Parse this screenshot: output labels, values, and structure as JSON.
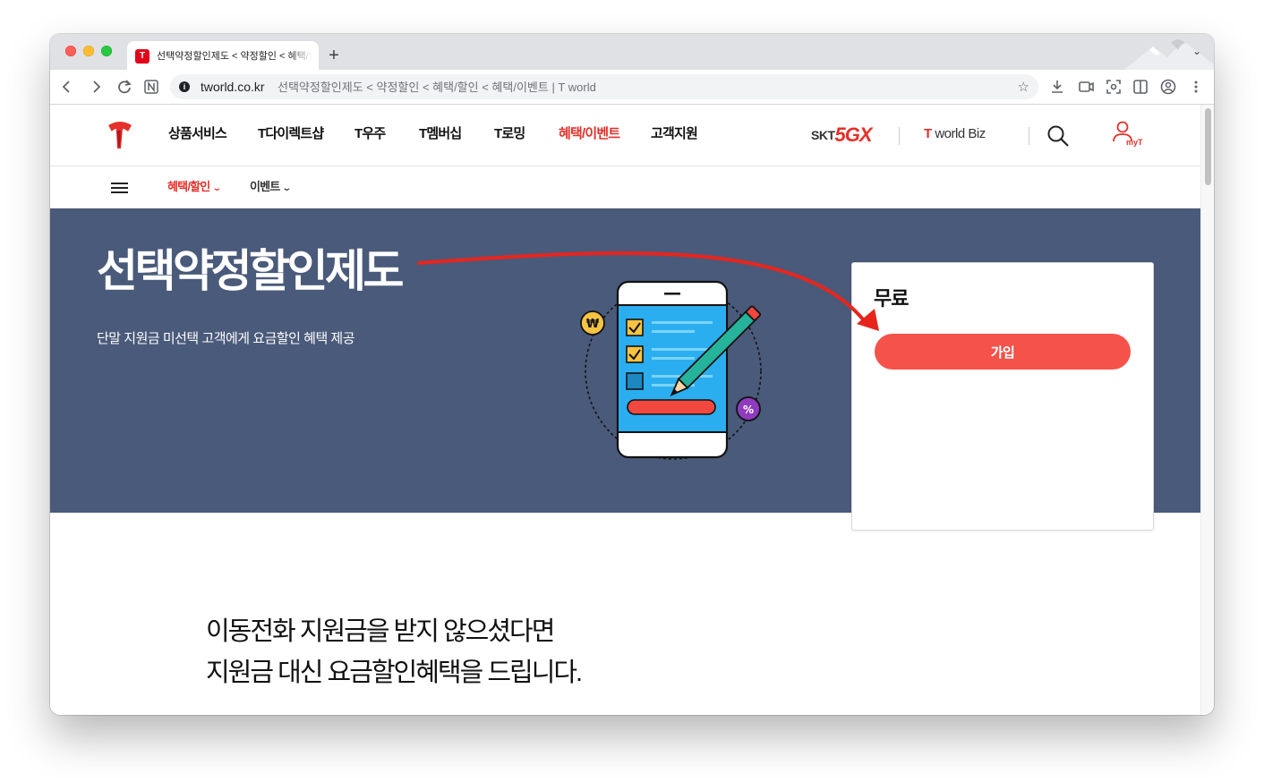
{
  "browser": {
    "tab_title": "선택약정할인제도 < 약정할인 < 혜택/할인 < 혜택/이벤트 | T world",
    "new_tab_label": "+",
    "tab_favicon_label": "T",
    "address": {
      "host": "tworld.co.kr",
      "title": "선택약정할인제도 < 약정할인 < 혜택/할인 < 혜택/이벤트 | T world"
    },
    "nav_icons": [
      "back-icon",
      "forward-icon",
      "reload-icon",
      "n-extension-icon"
    ],
    "toolbar_icons": [
      "bookmark-star-icon",
      "download-icon",
      "cast-icon",
      "screenshot-icon",
      "sidebar-icon",
      "profile-icon",
      "more-menu-icon"
    ]
  },
  "gnb": {
    "menu": [
      "상품서비스",
      "T다이렉트샵",
      "T우주",
      "T멤버십",
      "T로밍",
      "혜택/이벤트",
      "고객지원"
    ],
    "active_index": 5,
    "skt_label": "SKT",
    "fiveg_label": "5GX",
    "worldbiz_label": "world Biz",
    "myt_label": "myT"
  },
  "lnb": {
    "items": [
      "혜택/할인",
      "이벤트"
    ],
    "active_index": 0
  },
  "hero": {
    "title": "선택약정할인제도",
    "description": "단말 지원금 미선택 고객에게 요금할인 혜택 제공",
    "coin_symbol": "₩",
    "percent_symbol": "%"
  },
  "card": {
    "price": "무료",
    "join_label": "가입"
  },
  "content": {
    "headline_line1": "이동전화 지원금을 받지 않으셨다면",
    "headline_line2": "지원금 대신 요금할인혜택을 드립니다."
  },
  "colors": {
    "brand_red": "#e4302a",
    "hero_bg": "#4a5a7a",
    "join_button": "#f5524a",
    "annotation_arrow": "#e8251d"
  }
}
